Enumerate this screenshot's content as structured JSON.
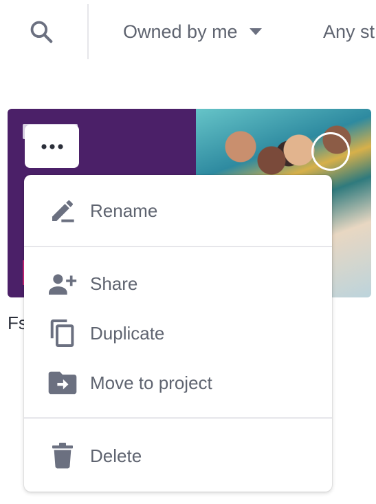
{
  "filters": {
    "owner_label": "Owned by me",
    "status_label": "Any st"
  },
  "card": {
    "title": "Fs"
  },
  "context_menu": {
    "items": [
      {
        "label": "Rename",
        "icon": "pencil-icon"
      },
      {
        "label": "Share",
        "icon": "add-person-icon"
      },
      {
        "label": "Duplicate",
        "icon": "copy-icon"
      },
      {
        "label": "Move to project",
        "icon": "move-to-folder-icon"
      },
      {
        "label": "Delete",
        "icon": "trash-icon"
      }
    ]
  },
  "colors": {
    "icon_gray": "#6b7080",
    "text_gray": "#5f6470",
    "card_purple": "#4b2068",
    "divider": "#e6e6ea"
  }
}
